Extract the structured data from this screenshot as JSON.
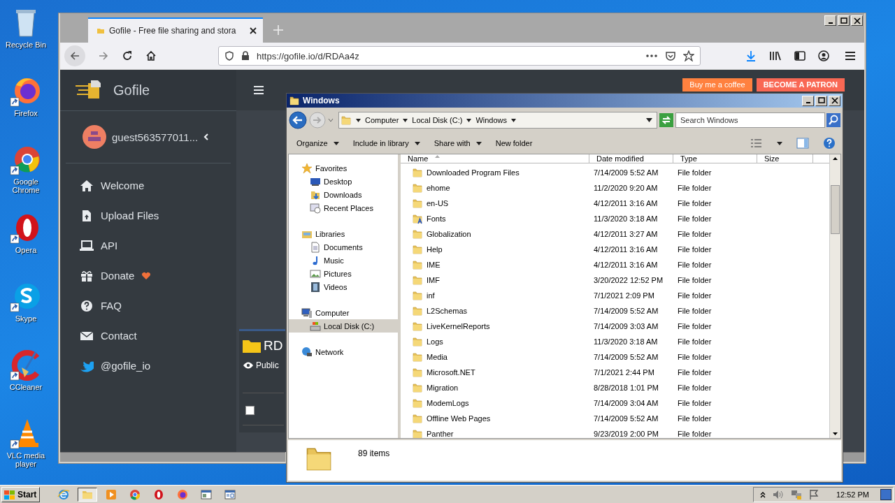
{
  "desktop": {
    "icons": [
      {
        "label": "Recycle Bin",
        "kind": "recycle"
      },
      {
        "label": "Firefox",
        "kind": "firefox"
      },
      {
        "label": "Google Chrome",
        "kind": "chrome"
      },
      {
        "label": "Opera",
        "kind": "opera"
      },
      {
        "label": "Skype",
        "kind": "skype"
      },
      {
        "label": "CCleaner",
        "kind": "ccleaner"
      },
      {
        "label": "VLC media player",
        "kind": "vlc"
      }
    ]
  },
  "browser": {
    "tab_title": "Gofile - Free file sharing and stora",
    "url": "https://gofile.io/d/RDAa4z"
  },
  "gofile": {
    "brand": "Gofile",
    "user": "guest563577011...",
    "menu": [
      {
        "label": "Welcome",
        "kind": "home",
        "heart": false
      },
      {
        "label": "Upload Files",
        "kind": "upload",
        "heart": false
      },
      {
        "label": "API",
        "kind": "api",
        "heart": false
      },
      {
        "label": "Donate",
        "kind": "gift",
        "heart": true
      },
      {
        "label": "FAQ",
        "kind": "question",
        "heart": false
      },
      {
        "label": "Contact",
        "kind": "envelope",
        "heart": false
      },
      {
        "label": "@gofile_io",
        "kind": "bird",
        "heart": false
      }
    ],
    "buttons": [
      {
        "label": "Buy me a coffee",
        "kind": "coffee"
      },
      {
        "label": "BECOME A PATRON",
        "kind": "patron"
      }
    ],
    "folder": {
      "name": "RD",
      "visibility": "Public",
      "checked": false
    }
  },
  "explorer": {
    "title": "Windows",
    "breadcrumb": [
      "Computer",
      "Local Disk (C:)",
      "Windows"
    ],
    "search_placeholder": "Search Windows",
    "commands": [
      {
        "label": "Organize",
        "dropdown": true
      },
      {
        "label": "Include in library",
        "dropdown": true
      },
      {
        "label": "Share with",
        "dropdown": true
      },
      {
        "label": "New folder",
        "dropdown": false
      }
    ],
    "nav": [
      {
        "label": "Favorites",
        "kind": "star",
        "selected": false,
        "children": [
          {
            "label": "Desktop",
            "kind": "desktop",
            "selected": false
          },
          {
            "label": "Downloads",
            "kind": "downloads",
            "selected": false
          },
          {
            "label": "Recent Places",
            "kind": "recent",
            "selected": false
          }
        ]
      },
      {
        "label": "Libraries",
        "kind": "library",
        "selected": false,
        "children": [
          {
            "label": "Documents",
            "kind": "document",
            "selected": false
          },
          {
            "label": "Music",
            "kind": "music",
            "selected": false
          },
          {
            "label": "Pictures",
            "kind": "pictures",
            "selected": false
          },
          {
            "label": "Videos",
            "kind": "videos",
            "selected": false
          }
        ]
      },
      {
        "label": "Computer",
        "kind": "computer",
        "selected": false,
        "children": [
          {
            "label": "Local Disk (C:)",
            "kind": "disk",
            "selected": true
          }
        ]
      },
      {
        "label": "Network",
        "kind": "network",
        "selected": false
      }
    ],
    "columns": [
      "Name",
      "Date modified",
      "Type",
      "Size"
    ],
    "rows": [
      {
        "name": "Downloaded Program Files",
        "date": "7/14/2009 5:52 AM",
        "type": "File folder",
        "kind": "folder"
      },
      {
        "name": "ehome",
        "date": "11/2/2020 9:20 AM",
        "type": "File folder",
        "kind": "folder"
      },
      {
        "name": "en-US",
        "date": "4/12/2011 3:16 AM",
        "type": "File folder",
        "kind": "folder"
      },
      {
        "name": "Fonts",
        "date": "11/3/2020 3:18 AM",
        "type": "File folder",
        "kind": "fonts"
      },
      {
        "name": "Globalization",
        "date": "4/12/2011 3:27 AM",
        "type": "File folder",
        "kind": "folder"
      },
      {
        "name": "Help",
        "date": "4/12/2011 3:16 AM",
        "type": "File folder",
        "kind": "folder"
      },
      {
        "name": "IME",
        "date": "4/12/2011 3:16 AM",
        "type": "File folder",
        "kind": "folder"
      },
      {
        "name": "IMF",
        "date": "3/20/2022 12:52 PM",
        "type": "File folder",
        "kind": "folder"
      },
      {
        "name": "inf",
        "date": "7/1/2021 2:09 PM",
        "type": "File folder",
        "kind": "folder"
      },
      {
        "name": "L2Schemas",
        "date": "7/14/2009 5:52 AM",
        "type": "File folder",
        "kind": "folder"
      },
      {
        "name": "LiveKernelReports",
        "date": "7/14/2009 3:03 AM",
        "type": "File folder",
        "kind": "folder"
      },
      {
        "name": "Logs",
        "date": "11/3/2020 3:18 AM",
        "type": "File folder",
        "kind": "folder"
      },
      {
        "name": "Media",
        "date": "7/14/2009 5:52 AM",
        "type": "File folder",
        "kind": "folder"
      },
      {
        "name": "Microsoft.NET",
        "date": "7/1/2021 2:44 PM",
        "type": "File folder",
        "kind": "folder"
      },
      {
        "name": "Migration",
        "date": "8/28/2018 1:01 PM",
        "type": "File folder",
        "kind": "folder"
      },
      {
        "name": "ModemLogs",
        "date": "7/14/2009 3:04 AM",
        "type": "File folder",
        "kind": "folder"
      },
      {
        "name": "Offline Web Pages",
        "date": "7/14/2009 5:52 AM",
        "type": "File folder",
        "kind": "folder"
      },
      {
        "name": "Panther",
        "date": "9/23/2019 2:00 PM",
        "type": "File folder",
        "kind": "folder"
      }
    ],
    "status": "89 items"
  },
  "taskbar": {
    "start": "Start",
    "apps": [
      {
        "kind": "ie",
        "selected": false
      },
      {
        "kind": "explorer",
        "selected": true
      },
      {
        "kind": "media",
        "selected": false
      },
      {
        "kind": "chrome",
        "selected": false
      },
      {
        "kind": "opera",
        "selected": false
      },
      {
        "kind": "firefox",
        "selected": false
      },
      {
        "kind": "window",
        "selected": false
      },
      {
        "kind": "window2",
        "selected": false
      }
    ],
    "clock": "12:52 PM"
  }
}
